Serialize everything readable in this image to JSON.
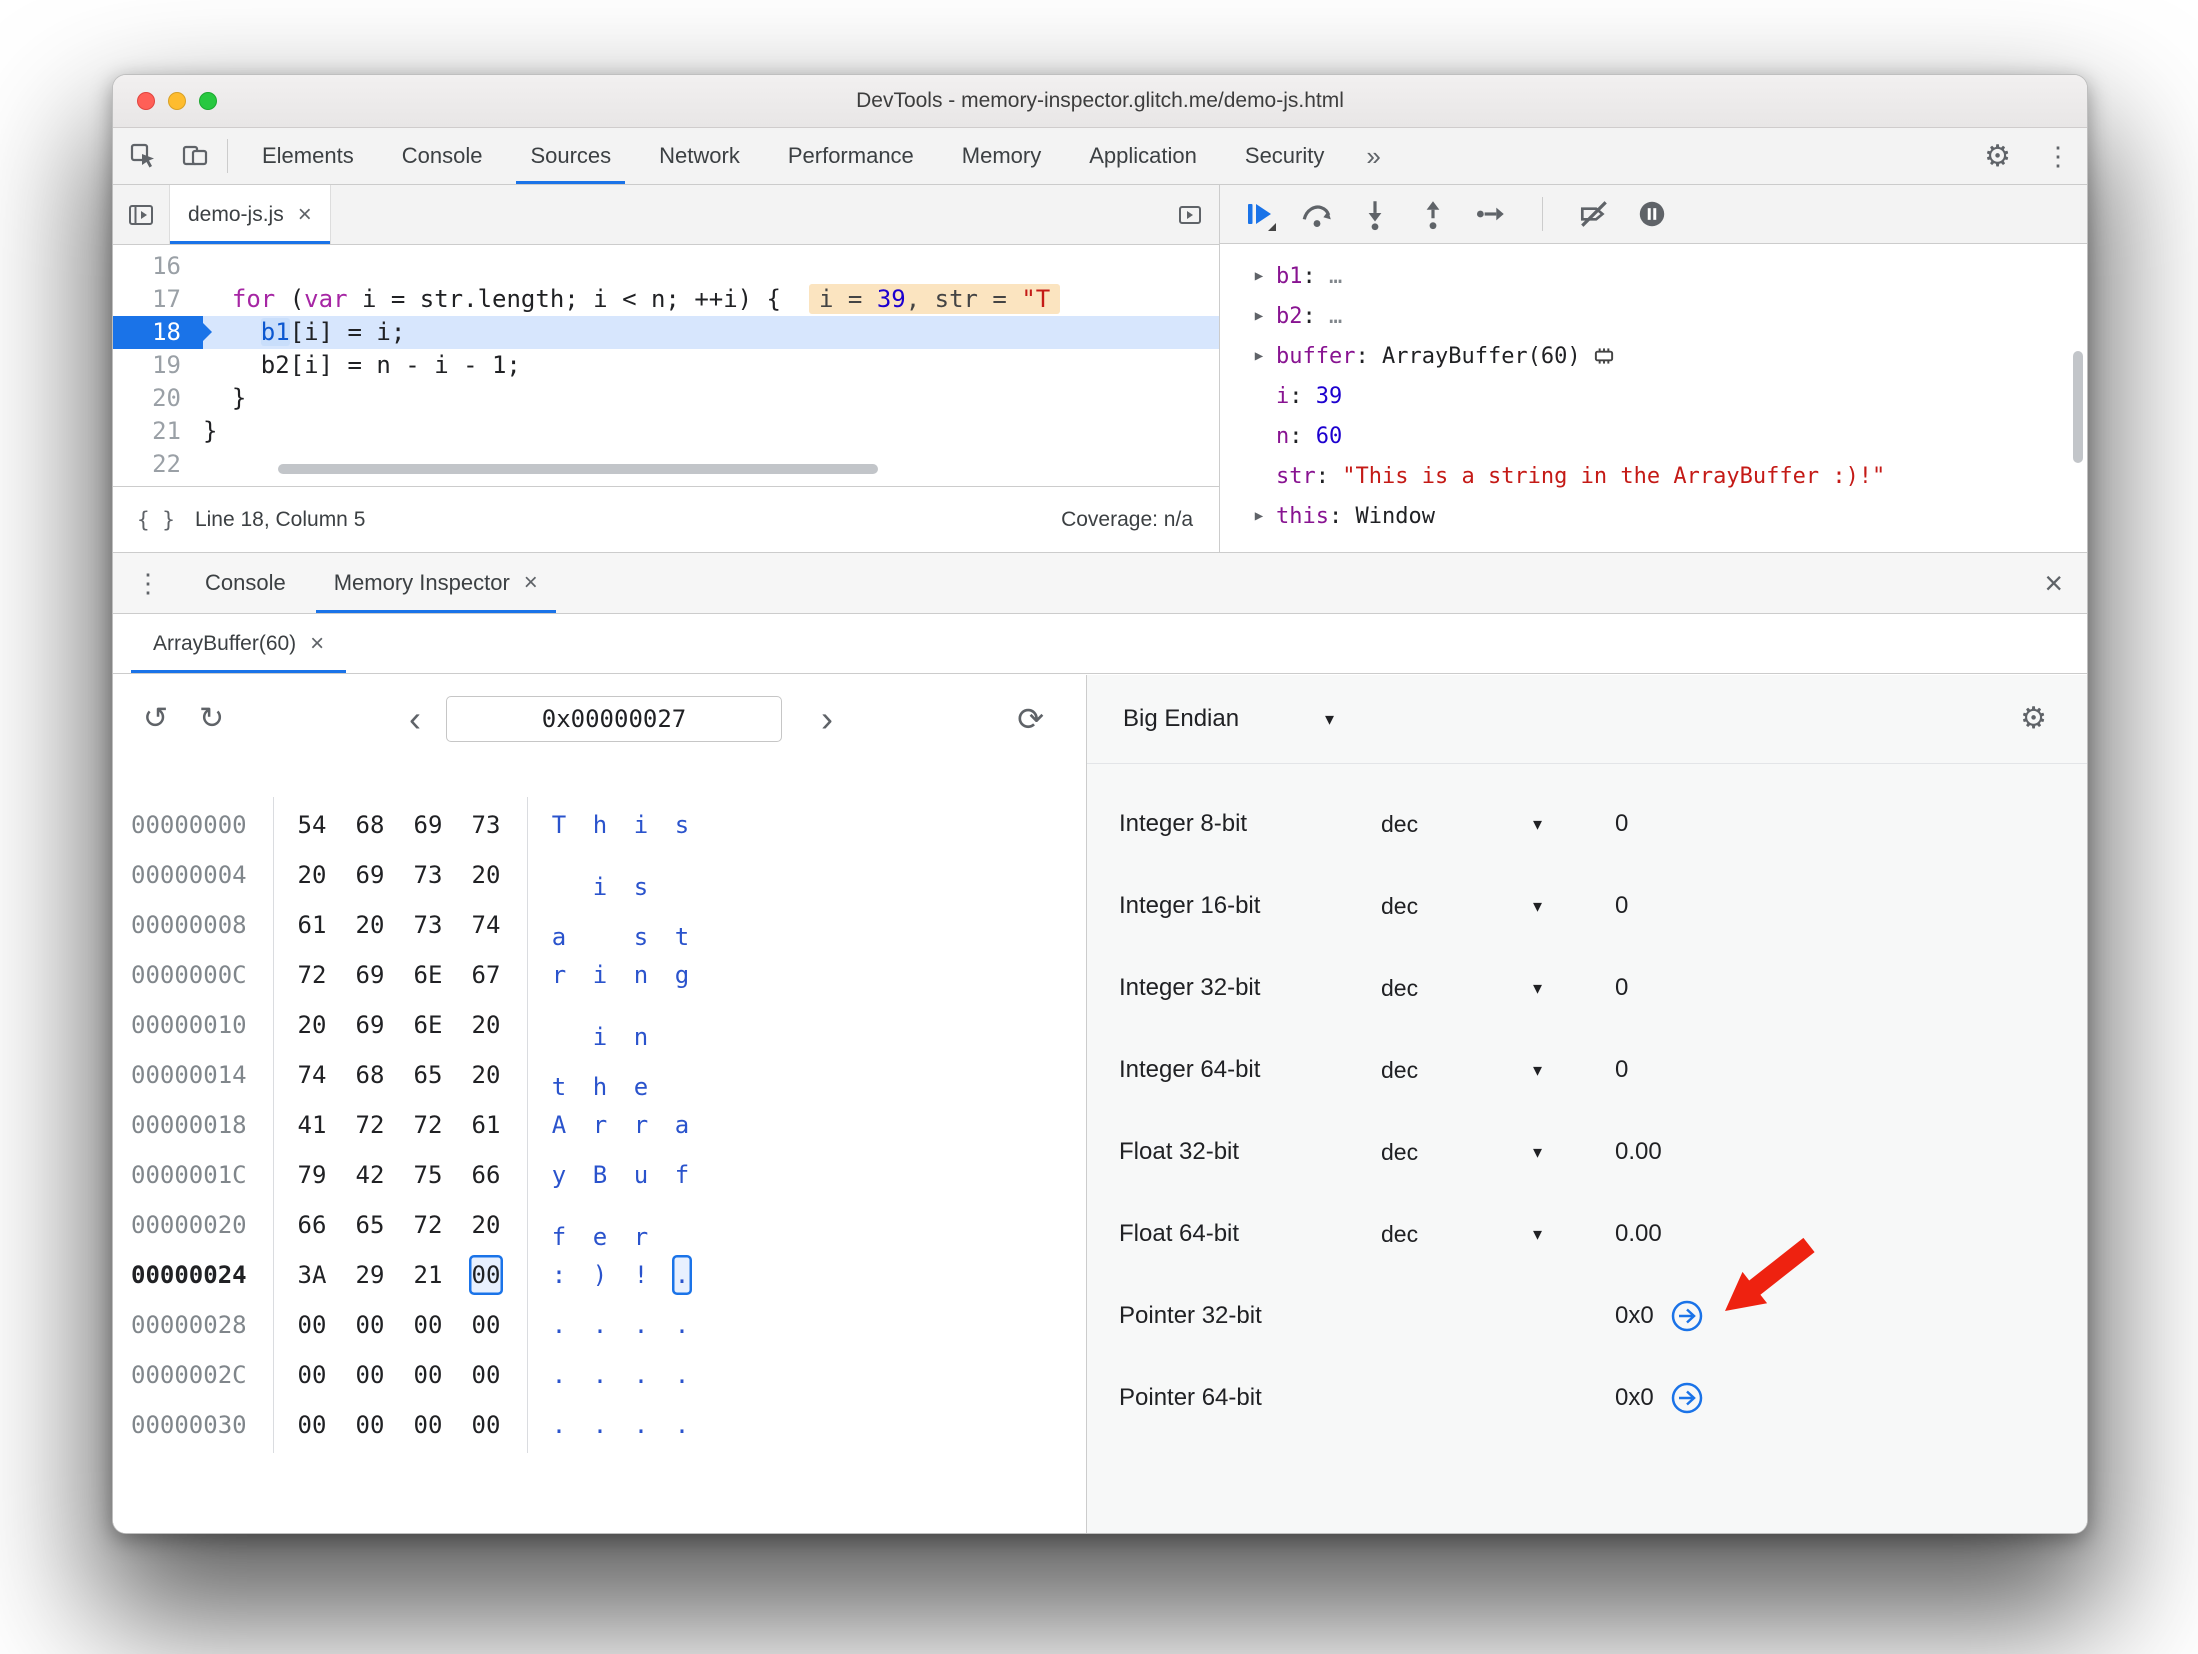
{
  "window": {
    "title": "DevTools - memory-inspector.glitch.me/demo-js.html"
  },
  "icons": {
    "undo": "↺",
    "redo": "↻",
    "back": "‹",
    "forward": "›",
    "refresh": "⟳",
    "gear": "⚙",
    "kebab": "⋮",
    "close": "×",
    "caret": "▾",
    "arrow": "▶",
    "braces": "{ }"
  },
  "main_toolbar": {
    "tabs": [
      "Elements",
      "Console",
      "Sources",
      "Network",
      "Performance",
      "Memory",
      "Application",
      "Security"
    ],
    "active_tab": "Sources",
    "more_label": "»"
  },
  "sources": {
    "file_tab": "demo-js.js",
    "lines": [
      {
        "no": "16",
        "tokens": []
      },
      {
        "no": "17",
        "tokens": [
          {
            "t": "  ",
            "c": "p"
          },
          {
            "t": "for",
            "c": "k"
          },
          {
            "t": " (",
            "c": "p"
          },
          {
            "t": "var",
            "c": "k"
          },
          {
            "t": " i = str.length; i < n; ++i) {",
            "c": "p"
          }
        ],
        "widget": [
          {
            "t": "i = ",
            "c": "wp"
          },
          {
            "t": "39",
            "c": "wn"
          },
          {
            "t": ", str = ",
            "c": "wp"
          },
          {
            "t": "\"T",
            "c": "ws"
          }
        ]
      },
      {
        "no": "18",
        "current": true,
        "tokens": [
          {
            "t": "    ",
            "c": "p"
          },
          {
            "t": "b1",
            "c": "hl"
          },
          {
            "t": "[i] = i;",
            "c": "p"
          }
        ]
      },
      {
        "no": "19",
        "tokens": [
          {
            "t": "    b2[i] = n - i - 1;",
            "c": "p"
          }
        ]
      },
      {
        "no": "20",
        "tokens": [
          {
            "t": "  }",
            "c": "p"
          }
        ]
      },
      {
        "no": "21",
        "tokens": [
          {
            "t": "}",
            "c": "p"
          }
        ]
      },
      {
        "no": "22",
        "tokens": []
      }
    ],
    "status": {
      "line_col": "Line 18, Column 5",
      "coverage": "Coverage: n/a"
    }
  },
  "debugger": {
    "scope": [
      {
        "expand": true,
        "name": "b1",
        "value": "…",
        "vc": "dim"
      },
      {
        "expand": true,
        "name": "b2",
        "value": "…",
        "vc": "dim"
      },
      {
        "expand": true,
        "name": "buffer",
        "value": "ArrayBuffer(60)",
        "vc": "obj",
        "icon": "memory"
      },
      {
        "expand": false,
        "name": "i",
        "value": "39",
        "vc": "num"
      },
      {
        "expand": false,
        "name": "n",
        "value": "60",
        "vc": "num"
      },
      {
        "expand": false,
        "name": "str",
        "value": "\"This is a string in the ArrayBuffer :)!\"",
        "vc": "str"
      },
      {
        "expand": true,
        "name": "this",
        "value": "Window",
        "vc": "obj"
      }
    ]
  },
  "drawer": {
    "tabs": [
      "Console",
      "Memory Inspector"
    ],
    "active": "Memory Inspector"
  },
  "memory_inspector": {
    "buffer_tab": "ArrayBuffer(60)",
    "address_value": "0x00000027",
    "endianness": "Big Endian",
    "hex_rows": [
      {
        "addr": "00000000",
        "bytes": [
          "54",
          "68",
          "69",
          "73"
        ],
        "ascii": [
          "T",
          "h",
          "i",
          "s"
        ]
      },
      {
        "addr": "00000004",
        "bytes": [
          "20",
          "69",
          "73",
          "20"
        ],
        "ascii": [
          " ",
          "i",
          "s",
          " "
        ]
      },
      {
        "addr": "00000008",
        "bytes": [
          "61",
          "20",
          "73",
          "74"
        ],
        "ascii": [
          "a",
          " ",
          "s",
          "t"
        ]
      },
      {
        "addr": "0000000C",
        "bytes": [
          "72",
          "69",
          "6E",
          "67"
        ],
        "ascii": [
          "r",
          "i",
          "n",
          "g"
        ]
      },
      {
        "addr": "00000010",
        "bytes": [
          "20",
          "69",
          "6E",
          "20"
        ],
        "ascii": [
          " ",
          "i",
          "n",
          " "
        ]
      },
      {
        "addr": "00000014",
        "bytes": [
          "74",
          "68",
          "65",
          "20"
        ],
        "ascii": [
          "t",
          "h",
          "e",
          " "
        ]
      },
      {
        "addr": "00000018",
        "bytes": [
          "41",
          "72",
          "72",
          "61"
        ],
        "ascii": [
          "A",
          "r",
          "r",
          "a"
        ]
      },
      {
        "addr": "0000001C",
        "bytes": [
          "79",
          "42",
          "75",
          "66"
        ],
        "ascii": [
          "y",
          "B",
          "u",
          "f"
        ]
      },
      {
        "addr": "00000020",
        "bytes": [
          "66",
          "65",
          "72",
          "20"
        ],
        "ascii": [
          "f",
          "e",
          "r",
          " "
        ]
      },
      {
        "addr": "00000024",
        "bytes": [
          "3A",
          "29",
          "21",
          "00"
        ],
        "ascii": [
          ":",
          ")",
          "!",
          "."
        ],
        "selected": 3
      },
      {
        "addr": "00000028",
        "bytes": [
          "00",
          "00",
          "00",
          "00"
        ],
        "ascii": [
          ".",
          ".",
          ".",
          "."
        ]
      },
      {
        "addr": "0000002C",
        "bytes": [
          "00",
          "00",
          "00",
          "00"
        ],
        "ascii": [
          ".",
          ".",
          ".",
          "."
        ]
      },
      {
        "addr": "00000030",
        "bytes": [
          "00",
          "00",
          "00",
          "00"
        ],
        "ascii": [
          ".",
          ".",
          ".",
          "."
        ]
      }
    ],
    "interpreter_rows": [
      {
        "label": "Integer 8-bit",
        "mode": "dec",
        "value": "0"
      },
      {
        "label": "Integer 16-bit",
        "mode": "dec",
        "value": "0"
      },
      {
        "label": "Integer 32-bit",
        "mode": "dec",
        "value": "0"
      },
      {
        "label": "Integer 64-bit",
        "mode": "dec",
        "value": "0"
      },
      {
        "label": "Float 32-bit",
        "mode": "dec",
        "value": "0.00"
      },
      {
        "label": "Float 64-bit",
        "mode": "dec",
        "value": "0.00"
      },
      {
        "label": "Pointer 32-bit",
        "mode": null,
        "value": "0x0",
        "jump": true,
        "annotated": true
      },
      {
        "label": "Pointer 64-bit",
        "mode": null,
        "value": "0x0",
        "jump": true
      }
    ]
  }
}
